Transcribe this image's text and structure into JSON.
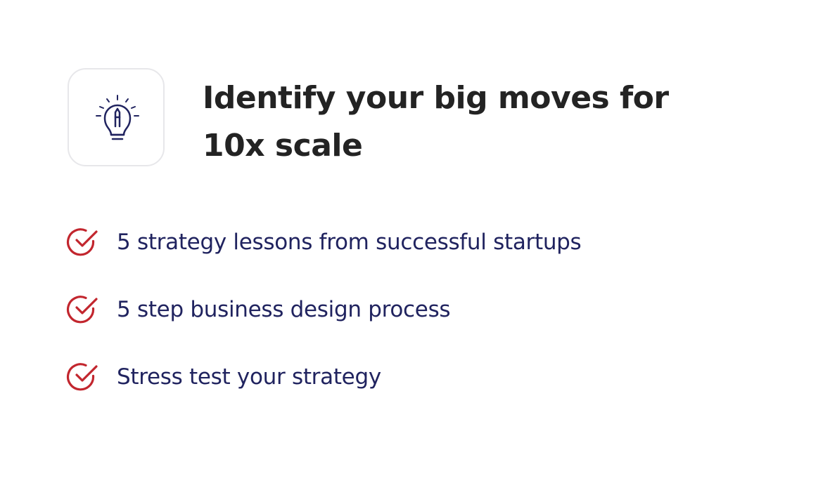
{
  "header": {
    "icon": "lightbulb-idea-icon",
    "title": "Identify your big moves for 10x scale"
  },
  "benefits": {
    "icon": "checkmark-circle-icon",
    "items": [
      {
        "label": "5 strategy lessons from successful startups"
      },
      {
        "label": "5 step business design process"
      },
      {
        "label": "Stress test your strategy"
      }
    ]
  },
  "colors": {
    "heading": "#232323",
    "list_text": "#20235f",
    "check": "#c2262e",
    "icon": "#20235f",
    "tile_border": "#e7e7ea"
  }
}
